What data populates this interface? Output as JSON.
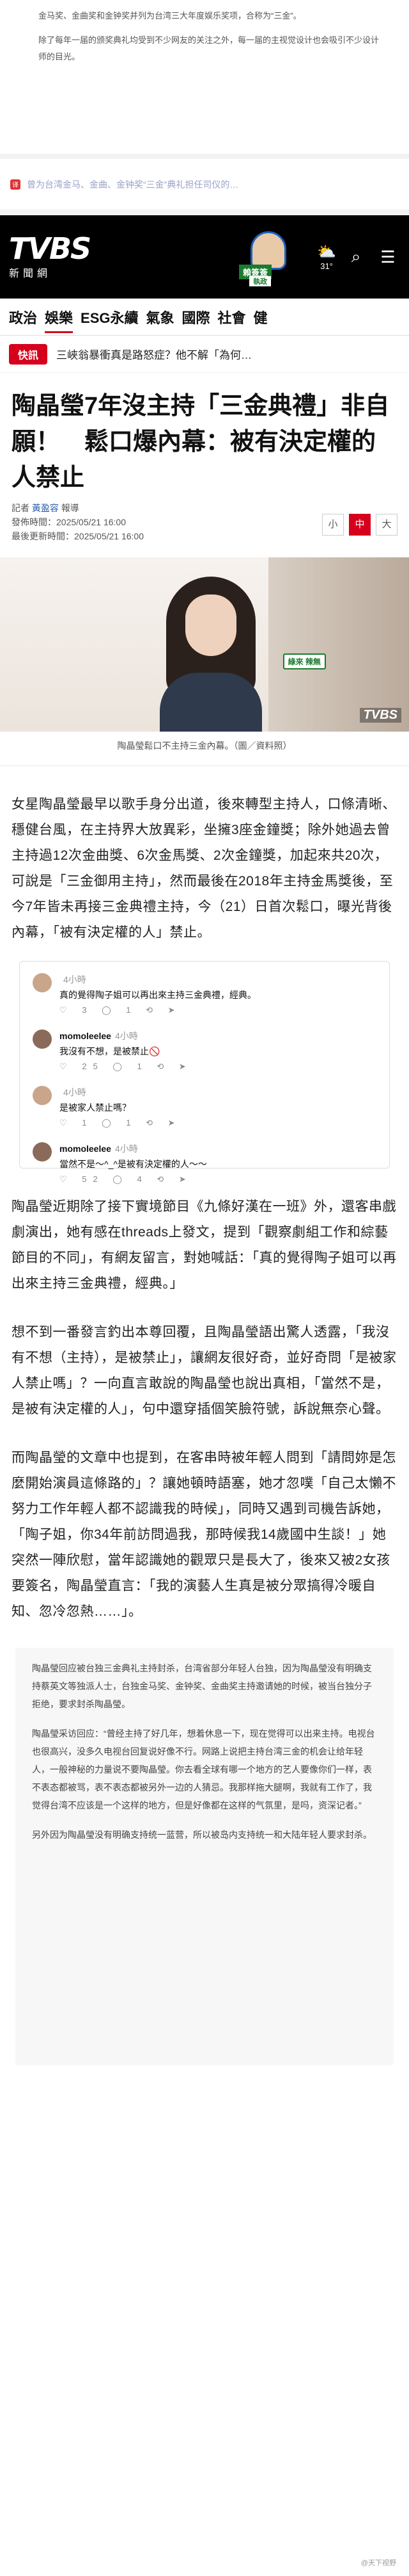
{
  "top_note": [
    "金马奖、金曲奖和金钟奖并列为台湾三大年度娱乐奖项，合称为“三金”。",
    "除了每年一届的颁奖典礼均受到不少网友的关注之外，每一届的主视觉设计也会吸引不少设计师的目光。"
  ],
  "translation_line": "曾为台湾金马、金曲、金钟奖“三金”典礼担任司仪的…",
  "header": {
    "logo_main": "TVBS",
    "logo_sub": "新聞網",
    "promo_tag": "賴簽簽",
    "promo_tag2": "執政",
    "weather_temp": "31°",
    "search_icon": "search-icon",
    "menu_icon": "menu-icon"
  },
  "nav": [
    "政治",
    "娛樂",
    "ESG永續",
    "氣象",
    "國際",
    "社會",
    "健"
  ],
  "nav_active": 1,
  "breaking": {
    "badge": "快訊",
    "text": "三峽翁暴衝真是路怒症？他不解「為何…"
  },
  "headline": "陶晶瑩7年沒主持「三金典禮」非自願！　鬆口爆內幕：被有決定權的人禁止",
  "meta": {
    "reporter_prefix": "記者",
    "reporter": "黃盈容",
    "reporter_suffix": "報導",
    "published": "發佈時間：2025/05/21 16:00",
    "updated": "最後更新時間：2025/05/21 16:00",
    "sizes": [
      "小",
      "中",
      "大"
    ]
  },
  "photo": {
    "label": "綠來\n辣無",
    "watermark": "TVBS",
    "caption": "陶晶瑩鬆口不主持三金內幕。（圖／資料照）"
  },
  "paragraphs": {
    "p1": "女星陶晶瑩最早以歌手身分出道，後來轉型主持人，口條清晰、穩健台風，在主持界大放異彩，坐擁3座金鐘獎；除外她過去曾主持過12次金曲獎、6次金馬獎、2次金鐘獎，加起來共20次，可說是「三金御用主持」，然而最後在2018年主持金馬獎後，至今7年皆未再接三金典禮主持，今（21）日首次鬆口，曝光背後內幕，「被有決定權的人」禁止。",
    "p2": "陶晶瑩近期除了接下實境節目《九條好漢在一班》外，還客串戲劇演出，她有感在threads上發文，提到「觀察劇組工作和綜藝節目的不同」，有網友留言，對她喊話：「真的覺得陶子姐可以再出來主持三金典禮，經典。」",
    "p3": "想不到一番發言釣出本尊回覆，且陶晶瑩語出驚人透露，「我沒有不想（主持），是被禁止」，讓網友很好奇，並好奇問「是被家人禁止嗎」？一向直言敢說的陶晶瑩也說出真相，「當然不是，是被有決定權的人」，句中還穿插個笑臉符號，訴說無奈心聲。",
    "p4": "而陶晶瑩的文章中也提到，在客串時被年輕人問到「請問妳是怎麼開始演員這條路的」？讓她頓時語塞，她才忽噗「自己太懶不努力工作年輕人都不認識我的時候」，同時又遇到司機告訴她，「陶子姐，你34年前訪問過我，那時候我14歲國中生談！」她突然一陣欣慰，當年認識她的觀眾只是長大了，後來又被2女孩要簽名，陶晶瑩直言：「我的演藝人生真是被分眾搞得冷暖自知、忽冷忽熱……」。"
  },
  "threads": [
    {
      "user": "",
      "time": "4小時",
      "text": "真的覺得陶子姐可以再出來主持三金典禮，經典。",
      "actions": "♡ 3 ◯ 1 ⟲ ➤"
    },
    {
      "user": "momoleelee",
      "time": "4小時",
      "text": "我沒有不想，是被禁止🚫",
      "actions": "♡ 25 ◯ 1 ⟲ ➤"
    },
    {
      "user": "",
      "time": "4小時",
      "text": "是被家人禁止嗎？",
      "actions": "♡ 1 ◯ 1 ⟲ ➤"
    },
    {
      "user": "momoleelee",
      "time": "4小時",
      "text": "當然不是～^_^是被有決定權的人～～",
      "actions": "♡ 52 ◯ 4 ⟲ ➤"
    }
  ],
  "translation_quote": [
    "陶晶瑩回应被台独三金典礼主持封杀，台湾省部分年轻人台独，因为陶晶瑩没有明确支持蔡英文等独派人士，台独金马奖、金钟奖、金曲奖主持邀请她的时候，被当台独分子拒绝，要求封杀陶晶瑩。",
    "陶晶瑩采访回应：“曾经主持了好几年，想着休息一下，现在觉得可以出来主持。电视台也很高兴，没多久电视台回复说好像不行。网路上说把主持台湾三金的机会让给年轻人，一般神秘的力量说不要陶晶瑩。你去看全球有哪一个地方的艺人要像你们一样，表不表态都被骂，表不表态都被另外一边的人猜忌。我那样拖大腿啊，我就有工作了，我觉得台湾不应该是一个这样的地方，但是好像都在这样的气氛里，是吗，资深记者。”",
    "另外因为陶晶瑩没有明确支持统一蓝营，所以被岛内支持统一和大陆年轻人要求封杀。"
  ],
  "weibo_mark": "@天下视野"
}
